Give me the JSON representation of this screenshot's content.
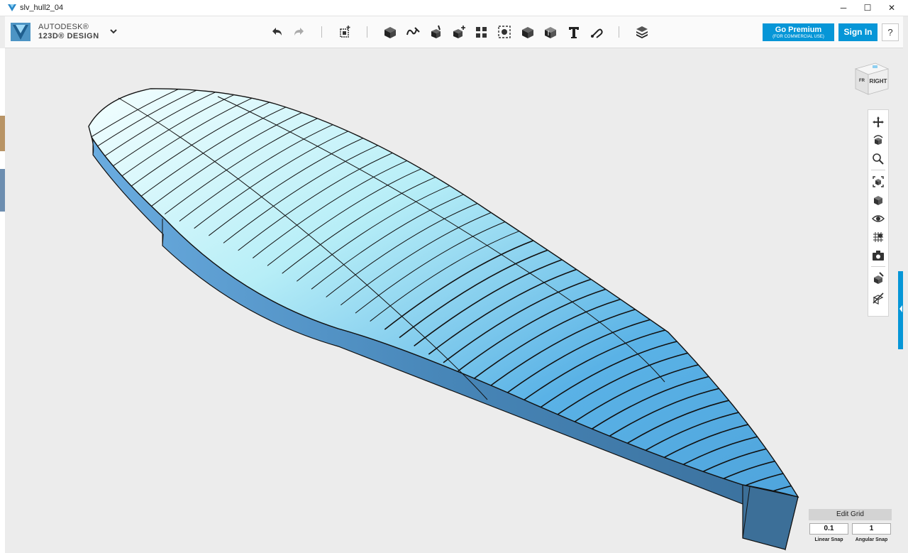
{
  "window": {
    "title": "slv_hull2_04",
    "controls": {
      "minimize": "─",
      "maximize": "☐",
      "close": "✕"
    }
  },
  "toolbar": {
    "brand_line1": "AUTODESK®",
    "brand_line2": "123D® DESIGN",
    "icons": [
      "undo-icon",
      "redo-icon",
      "transform-icon",
      "primitives-icon",
      "sketch-icon",
      "construct-icon",
      "modify-icon",
      "pattern-icon",
      "group-icon",
      "combine-icon",
      "measure-icon",
      "text-icon",
      "snap-icon",
      "material-icon"
    ],
    "premium_label": "Go Premium",
    "premium_sub": "(FOR COMMERCIAL USE)",
    "signin_label": "Sign In",
    "help_label": "?"
  },
  "viewcube": {
    "face_label": "RIGHT",
    "side_label": "FR"
  },
  "navbar": {
    "icons": [
      "pan-icon",
      "orbit-icon",
      "zoom-icon",
      "fit-icon",
      "view-mode-icon",
      "visibility-icon",
      "grid-icon",
      "camera-icon",
      "material-icon",
      "outline-icon"
    ]
  },
  "snap": {
    "edit_grid_label": "Edit Grid",
    "linear_value": "0.1",
    "linear_label": "Linear Snap",
    "angular_value": "1",
    "angular_label": "Angular Snap"
  },
  "colors": {
    "accent": "#0696d7",
    "hull_top_light": "#c4f4f8",
    "hull_top": "#5ab2e6",
    "hull_side": "#3f77a3"
  }
}
